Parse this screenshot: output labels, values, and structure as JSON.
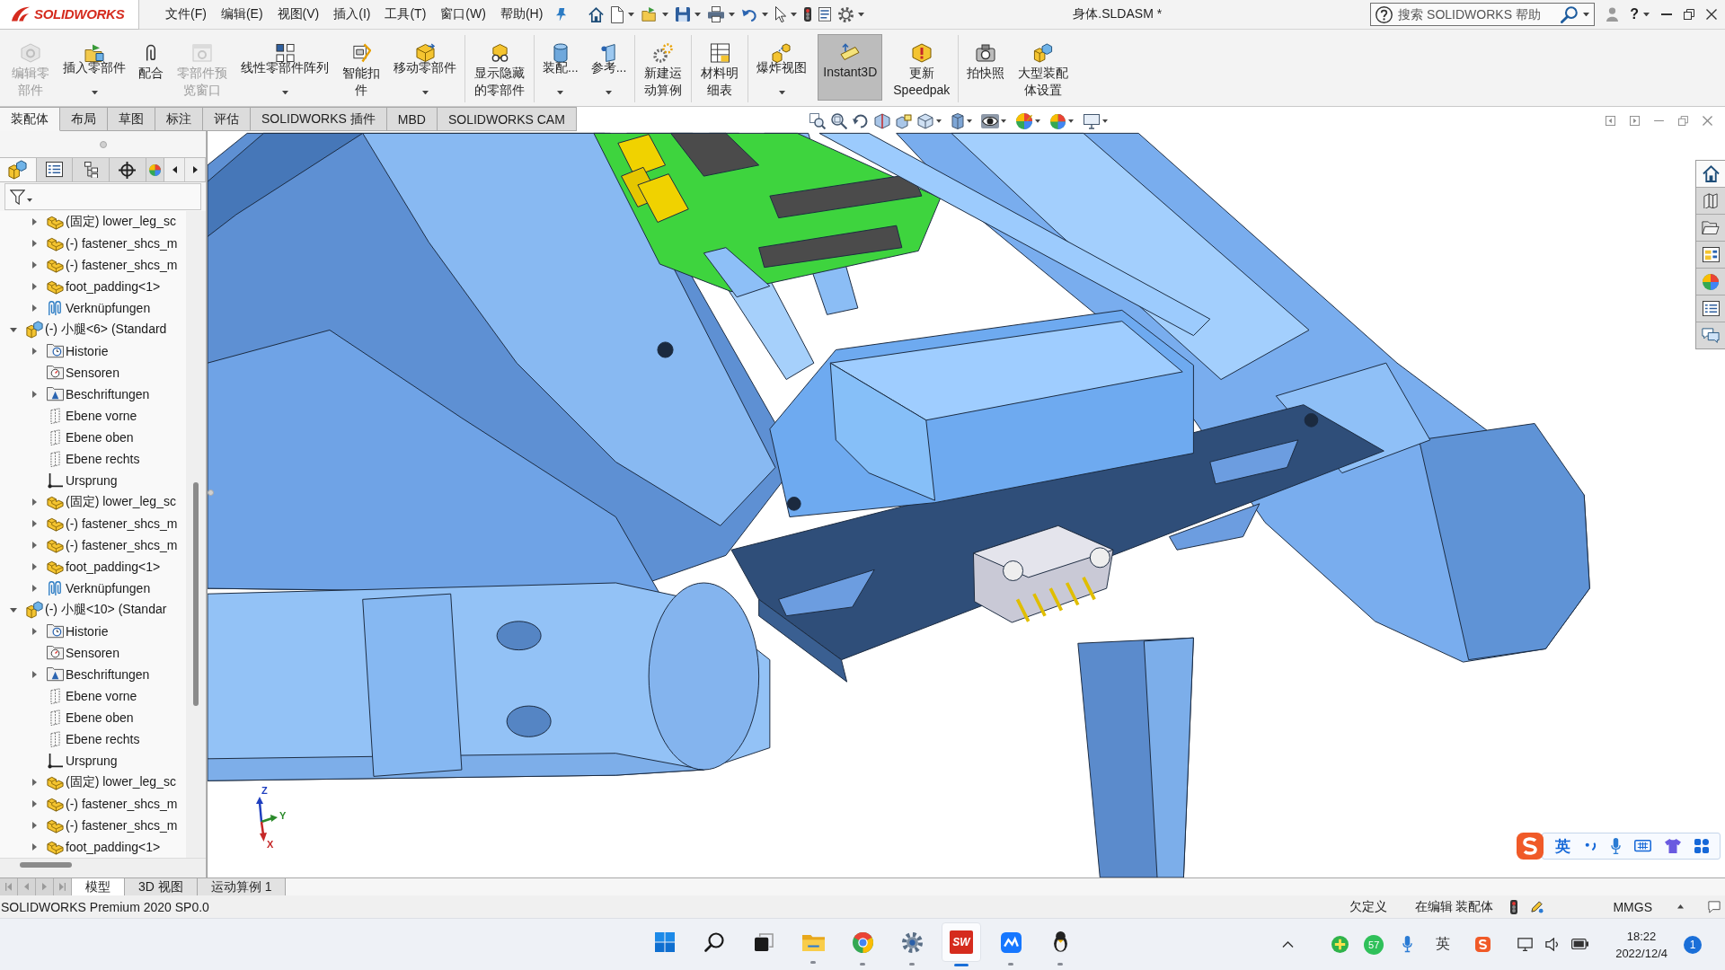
{
  "window": {
    "logo_text": "SOLIDWORKS",
    "menu": [
      "文件(F)",
      "编辑(E)",
      "视图(V)",
      "插入(I)",
      "工具(T)",
      "窗口(W)",
      "帮助(H)"
    ],
    "title": "身体.SLDASM *",
    "search": {
      "placeholder": "搜索 SOLIDWORKS 帮助"
    },
    "help": "?"
  },
  "command_manager": {
    "groups": [
      [
        {
          "label": "编辑零部件",
          "disabled": true,
          "dropdown": false,
          "active": false
        },
        {
          "label": "插入零部件",
          "disabled": false,
          "dropdown": true,
          "active": false
        },
        {
          "label": "配合",
          "disabled": false,
          "dropdown": false,
          "active": false
        },
        {
          "label": "零部件预览窗口",
          "disabled": true,
          "dropdown": false,
          "active": false
        },
        {
          "label": "线性零部件阵列",
          "disabled": false,
          "dropdown": true,
          "active": false
        },
        {
          "label": "智能扣件",
          "disabled": false,
          "dropdown": false,
          "active": false
        },
        {
          "label": "移动零部件",
          "disabled": false,
          "dropdown": true,
          "active": false
        }
      ],
      [
        {
          "label": "显示隐藏的零部件",
          "disabled": false,
          "dropdown": false,
          "active": false
        }
      ],
      [
        {
          "label": "装配...",
          "disabled": false,
          "dropdown": true,
          "active": false
        },
        {
          "label": "参考...",
          "disabled": false,
          "dropdown": true,
          "active": false
        }
      ],
      [
        {
          "label": "新建运动算例",
          "disabled": false,
          "dropdown": false,
          "active": false
        }
      ],
      [
        {
          "label": "材料明细表",
          "disabled": false,
          "dropdown": false,
          "active": false
        }
      ],
      [
        {
          "label": "爆炸视图",
          "disabled": false,
          "dropdown": true,
          "active": false
        },
        {
          "label": "Instant3D",
          "disabled": false,
          "dropdown": false,
          "active": true
        },
        {
          "label": "更新\nSpeedpak",
          "disabled": false,
          "dropdown": false,
          "active": false
        }
      ],
      [
        {
          "label": "拍快照",
          "disabled": false,
          "dropdown": false,
          "active": false
        },
        {
          "label": "大型装配体设置",
          "disabled": false,
          "dropdown": false,
          "active": false
        }
      ]
    ],
    "tabs": [
      {
        "label": "装配体",
        "selected": true
      },
      {
        "label": "布局",
        "selected": false
      },
      {
        "label": "草图",
        "selected": false
      },
      {
        "label": "标注",
        "selected": false
      },
      {
        "label": "评估",
        "selected": false
      },
      {
        "label": "SOLIDWORKS 插件",
        "selected": false
      },
      {
        "label": "MBD",
        "selected": false
      },
      {
        "label": "SOLIDWORKS CAM",
        "selected": false
      }
    ]
  },
  "feature_manager": {
    "view_tabs": [
      {
        "selected": true
      },
      {
        "selected": false
      },
      {
        "selected": false
      },
      {
        "selected": false
      },
      {
        "selected": false
      }
    ],
    "tree": {
      "leading_children": [
        {
          "label": "(固定) lower_leg_sc",
          "kind": "part",
          "expanded": false
        },
        {
          "label": "(-) fastener_shcs_m",
          "kind": "part",
          "expanded": false
        },
        {
          "label": "(-) fastener_shcs_m",
          "kind": "part",
          "expanded": false
        },
        {
          "label": "foot_padding<1>",
          "kind": "part",
          "expanded": false
        },
        {
          "label": "Verknüpfungen",
          "kind": "mates",
          "expanded": false
        }
      ],
      "items": [
        {
          "label": "(-) 小腿<6> (Standard",
          "kind": "assembly",
          "expanded": true,
          "children": [
            {
              "label": "Historie",
              "kind": "history",
              "expanded": false
            },
            {
              "label": "Sensoren",
              "kind": "sensors"
            },
            {
              "label": "Beschriftungen",
              "kind": "annotations",
              "expanded": false
            },
            {
              "label": "Ebene vorne",
              "kind": "plane"
            },
            {
              "label": "Ebene oben",
              "kind": "plane"
            },
            {
              "label": "Ebene rechts",
              "kind": "plane"
            },
            {
              "label": "Ursprung",
              "kind": "origin"
            },
            {
              "label": "(固定) lower_leg_sc",
              "kind": "part",
              "expanded": false
            },
            {
              "label": "(-) fastener_shcs_m",
              "kind": "part",
              "expanded": false
            },
            {
              "label": "(-) fastener_shcs_m",
              "kind": "part",
              "expanded": false
            },
            {
              "label": "foot_padding<1>",
              "kind": "part",
              "expanded": false
            },
            {
              "label": "Verknüpfungen",
              "kind": "mates",
              "expanded": false
            }
          ]
        },
        {
          "label": "(-) 小腿<10> (Standar",
          "kind": "assembly",
          "expanded": true,
          "children": [
            {
              "label": "Historie",
              "kind": "history",
              "expanded": false
            },
            {
              "label": "Sensoren",
              "kind": "sensors"
            },
            {
              "label": "Beschriftungen",
              "kind": "annotations",
              "expanded": false
            },
            {
              "label": "Ebene vorne",
              "kind": "plane"
            },
            {
              "label": "Ebene oben",
              "kind": "plane"
            },
            {
              "label": "Ebene rechts",
              "kind": "plane"
            },
            {
              "label": "Ursprung",
              "kind": "origin"
            },
            {
              "label": "(固定) lower_leg_sc",
              "kind": "part",
              "expanded": false
            },
            {
              "label": "(-) fastener_shcs_m",
              "kind": "part",
              "expanded": false
            },
            {
              "label": "(-) fastener_shcs_m",
              "kind": "part",
              "expanded": false
            },
            {
              "label": "foot_padding<1>",
              "kind": "part",
              "expanded": false
            }
          ]
        }
      ]
    }
  },
  "viewport": {
    "view_toolbar": [
      {
        "active": false
      },
      {
        "active": false
      },
      {
        "active": false
      },
      {
        "active": false
      },
      {
        "active": false
      },
      {
        "active": false
      },
      {
        "active": false
      },
      {
        "active": true
      },
      {
        "active": false
      },
      {
        "active": false
      },
      {
        "active": false
      }
    ],
    "triad": {
      "z_label": "Z",
      "y_label": "Y",
      "x_label": "X"
    },
    "task_pane": [
      {
        "selected": true
      },
      {
        "selected": false
      },
      {
        "selected": false
      },
      {
        "selected": false
      },
      {
        "selected": false
      },
      {
        "selected": false
      },
      {
        "selected": false
      }
    ],
    "ime_toolbar": {
      "mode": "英"
    }
  },
  "bottom_tabs": [
    {
      "label": "模型",
      "selected": true
    },
    {
      "label": "3D 视图",
      "selected": false
    },
    {
      "label": "运动算例 1",
      "selected": false
    }
  ],
  "status_bar": {
    "product": "SOLIDWORKS Premium 2020 SP0.0",
    "definition": "欠定义",
    "mode": "在编辑 装配体",
    "units": "MMGS"
  },
  "taskbar": {
    "apps": [
      {
        "running": false,
        "selected": false
      },
      {
        "running": false,
        "selected": false
      },
      {
        "running": false,
        "selected": false
      },
      {
        "running": true,
        "selected": false
      },
      {
        "running": true,
        "selected": false
      },
      {
        "running": true,
        "selected": false
      },
      {
        "running": true,
        "selected": true,
        "logo_text": "SW"
      },
      {
        "running": true,
        "selected": false
      },
      {
        "running": true,
        "selected": false
      }
    ],
    "tray": {
      "counter": "57",
      "input_mode": "英",
      "time": "18:22",
      "date": "2022/12/4",
      "notifications": "1"
    }
  }
}
